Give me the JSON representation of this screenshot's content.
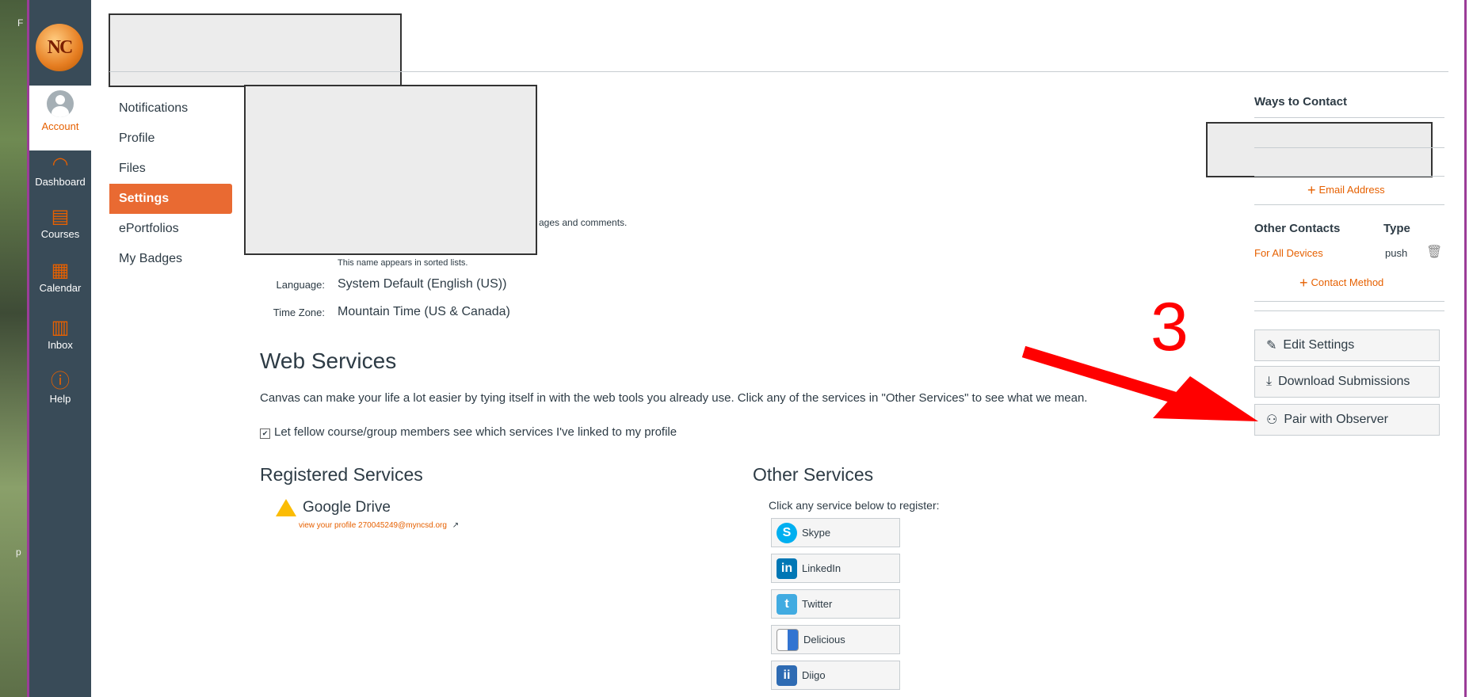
{
  "desktop": {
    "letters": [
      "F",
      "p"
    ]
  },
  "global_nav": {
    "account": "Account",
    "dashboard": "Dashboard",
    "courses": "Courses",
    "calendar": "Calendar",
    "inbox": "Inbox",
    "help": "Help",
    "logo_text": "NC"
  },
  "sub_nav": {
    "items": [
      "Notifications",
      "Profile",
      "Files",
      "Settings",
      "ePortfolios",
      "My Badges"
    ],
    "active": "Settings"
  },
  "profile": {
    "partial_text": "ages and comments.",
    "sortable_hint": "This name appears in sorted lists.",
    "language_label": "Language:",
    "language_value": "System Default (English (US))",
    "timezone_label": "Time Zone:",
    "timezone_value": "Mountain Time (US & Canada)"
  },
  "web_services": {
    "heading": "Web Services",
    "description": "Canvas can make your life a lot easier by tying itself in with the web tools you already use. Click any of the services in \"Other Services\" to see what we mean.",
    "checkbox_label": "Let fellow course/group members see which services I've linked to my profile",
    "checkbox_checked": true
  },
  "registered_services": {
    "heading": "Registered Services",
    "items": [
      {
        "name": "Google Drive",
        "link": "view your profile 270045249@myncsd.org"
      }
    ]
  },
  "other_services": {
    "heading": "Other Services",
    "hint": "Click any service below to register:",
    "items": [
      "Skype",
      "LinkedIn",
      "Twitter",
      "Delicious",
      "Diigo"
    ]
  },
  "sidebar": {
    "ways_title": "Ways to Contact",
    "add_email": "Email Address",
    "other_contacts": "Other Contacts",
    "type": "Type",
    "contact_name": "For All Devices",
    "contact_type": "push",
    "add_contact": "Contact Method",
    "buttons": {
      "edit": "Edit Settings",
      "download": "Download Submissions",
      "pair": "Pair with Observer"
    }
  },
  "annotation": {
    "number": "3",
    "color": "#ff0000"
  },
  "colors": {
    "accent": "#e66000",
    "nav_bg": "#394b58",
    "frame": "#9b3d97"
  }
}
